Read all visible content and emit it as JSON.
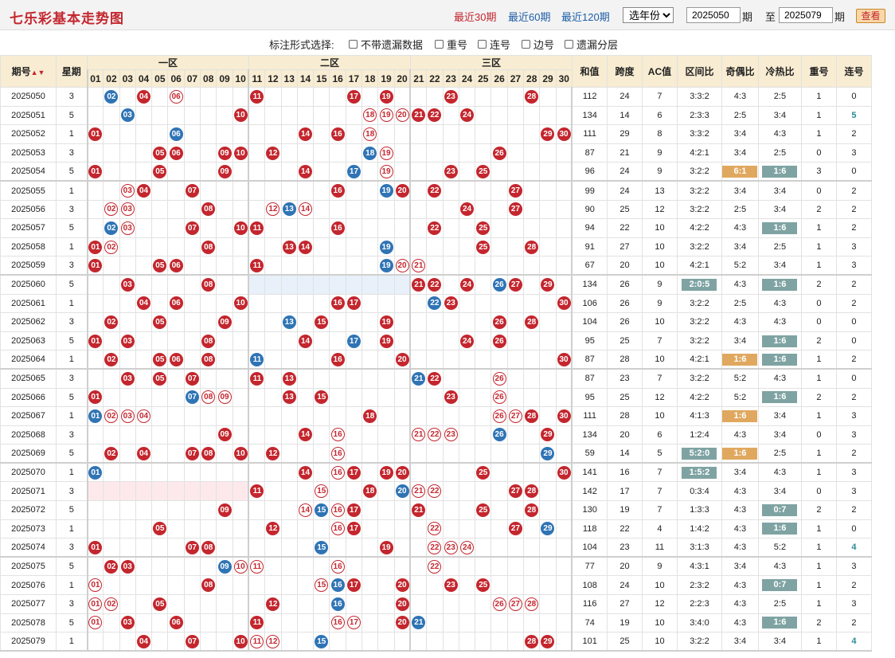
{
  "header": {
    "title": "七乐彩基本走势图",
    "periods": [
      "最近30期",
      "最近60期",
      "最近120期"
    ],
    "year_select": "选年份",
    "from": "2025050",
    "to": "2025079",
    "label_qi": "期",
    "label_zhi": "至",
    "query": "查看"
  },
  "options": {
    "label": "标注形式选择:",
    "items": [
      "不带遗漏数据",
      "重号",
      "连号",
      "边号",
      "遗漏分层"
    ]
  },
  "columns": {
    "issue": "期号",
    "week": "星期",
    "zones": [
      "一区",
      "二区",
      "三区"
    ],
    "sum": "和值",
    "span": "跨度",
    "ac": "AC值",
    "zone_ratio": "区间比",
    "odd_even": "奇偶比",
    "hot_cold": "冷热比",
    "repeat": "重号",
    "consec": "连号"
  },
  "numbers": [
    "01",
    "02",
    "03",
    "04",
    "05",
    "06",
    "07",
    "08",
    "09",
    "10",
    "11",
    "12",
    "13",
    "14",
    "15",
    "16",
    "17",
    "18",
    "19",
    "20",
    "21",
    "22",
    "23",
    "24",
    "25",
    "26",
    "27",
    "28",
    "29",
    "30"
  ],
  "colors": {
    "red": "#c4262e",
    "blue": "#2f74b5",
    "tag_gray": "#7fa3a3",
    "tag_orange": "#e0a85f",
    "header_bg": "#f8ecd2"
  },
  "rows": [
    {
      "i": "2025050",
      "w": "3",
      "r": [
        4,
        11,
        17,
        19,
        23,
        28
      ],
      "o": [
        6
      ],
      "bl": [
        2
      ],
      "s": "112",
      "sp": "24",
      "ac": "7",
      "zr": "3:3:2",
      "oe": "4:3",
      "hc": "2:5",
      "rp": "1",
      "cn": "0"
    },
    {
      "i": "2025051",
      "w": "5",
      "r": [
        10,
        21,
        22,
        24
      ],
      "o": [
        18,
        19,
        20
      ],
      "bl": [
        3
      ],
      "s": "134",
      "sp": "14",
      "ac": "6",
      "zr": "2:3:3",
      "oe": "2:5",
      "hc": "3:4",
      "rp": "1",
      "cn": "5",
      "cnh": true
    },
    {
      "i": "2025052",
      "w": "1",
      "r": [
        1,
        14,
        16,
        29,
        30
      ],
      "o": [
        18
      ],
      "bl": [
        6
      ],
      "s": "111",
      "sp": "29",
      "ac": "8",
      "zr": "3:3:2",
      "oe": "3:4",
      "hc": "4:3",
      "rp": "1",
      "cn": "2"
    },
    {
      "i": "2025053",
      "w": "3",
      "r": [
        5,
        6,
        9,
        10,
        12,
        26
      ],
      "o": [
        19
      ],
      "bl": [
        18
      ],
      "s": "87",
      "sp": "21",
      "ac": "9",
      "zr": "4:2:1",
      "oe": "3:4",
      "hc": "2:5",
      "rp": "0",
      "cn": "3"
    },
    {
      "i": "2025054",
      "w": "5",
      "r": [
        1,
        5,
        9,
        14,
        23,
        25
      ],
      "o": [
        19
      ],
      "bl": [
        17
      ],
      "s": "96",
      "sp": "24",
      "ac": "9",
      "zr": "3:2:2",
      "oe": "6:1",
      "oet": "or",
      "hc": "1:6",
      "hct": "gr",
      "rp": "3",
      "cn": "0"
    },
    {
      "i": "2025055",
      "w": "1",
      "r": [
        4,
        7,
        16,
        20,
        22,
        27
      ],
      "o": [
        3
      ],
      "bl": [
        19
      ],
      "s": "99",
      "sp": "24",
      "ac": "13",
      "zr": "3:2:2",
      "oe": "3:4",
      "hc": "3:4",
      "rp": "0",
      "cn": "2"
    },
    {
      "i": "2025056",
      "w": "3",
      "r": [
        8,
        24,
        27
      ],
      "o": [
        2,
        3,
        12,
        14
      ],
      "bl": [
        13
      ],
      "s": "90",
      "sp": "25",
      "ac": "12",
      "zr": "3:2:2",
      "oe": "2:5",
      "hc": "3:4",
      "rp": "2",
      "cn": "2"
    },
    {
      "i": "2025057",
      "w": "5",
      "r": [
        7,
        10,
        11,
        16,
        22,
        25
      ],
      "o": [
        3
      ],
      "bl": [
        2
      ],
      "s": "94",
      "sp": "22",
      "ac": "10",
      "zr": "4:2:2",
      "oe": "4:3",
      "hc": "1:6",
      "hct": "gr",
      "rp": "1",
      "cn": "2"
    },
    {
      "i": "2025058",
      "w": "1",
      "r": [
        1,
        8,
        13,
        14,
        25,
        28
      ],
      "o": [
        2
      ],
      "bl": [
        19
      ],
      "s": "91",
      "sp": "27",
      "ac": "10",
      "zr": "3:2:2",
      "oe": "3:4",
      "hc": "2:5",
      "rp": "1",
      "cn": "3"
    },
    {
      "i": "2025059",
      "w": "3",
      "r": [
        1,
        5,
        6,
        11
      ],
      "o": [
        20,
        21
      ],
      "bl": [
        19
      ],
      "s": "67",
      "sp": "20",
      "ac": "10",
      "zr": "4:2:1",
      "oe": "5:2",
      "hc": "3:4",
      "rp": "1",
      "cn": "3"
    },
    {
      "i": "2025060",
      "w": "5",
      "r": [
        3,
        8,
        21,
        22,
        24,
        27,
        29
      ],
      "o": [],
      "bl": [
        26
      ],
      "s": "134",
      "sp": "26",
      "ac": "9",
      "zr": "2:0:5",
      "zrt": "gr",
      "oe": "4:3",
      "hc": "1:6",
      "hct": "gr",
      "rp": "2",
      "cn": "2",
      "sh": "z2"
    },
    {
      "i": "2025061",
      "w": "1",
      "r": [
        4,
        6,
        10,
        16,
        17,
        23,
        30
      ],
      "o": [],
      "bl": [
        22
      ],
      "s": "106",
      "sp": "26",
      "ac": "9",
      "zr": "3:2:2",
      "oe": "2:5",
      "hc": "4:3",
      "rp": "0",
      "cn": "2"
    },
    {
      "i": "2025062",
      "w": "3",
      "r": [
        2,
        5,
        9,
        15,
        19,
        26,
        28
      ],
      "o": [],
      "bl": [
        13
      ],
      "s": "104",
      "sp": "26",
      "ac": "10",
      "zr": "3:2:2",
      "oe": "4:3",
      "hc": "4:3",
      "rp": "0",
      "cn": "0"
    },
    {
      "i": "2025063",
      "w": "5",
      "r": [
        1,
        3,
        8,
        14,
        19,
        24,
        26
      ],
      "o": [],
      "bl": [
        17
      ],
      "s": "95",
      "sp": "25",
      "ac": "7",
      "zr": "3:2:2",
      "oe": "3:4",
      "hc": "1:6",
      "hct": "gr",
      "rp": "2",
      "cn": "0"
    },
    {
      "i": "2025064",
      "w": "1",
      "r": [
        2,
        5,
        6,
        8,
        16,
        20,
        30
      ],
      "o": [],
      "bl": [
        11
      ],
      "s": "87",
      "sp": "28",
      "ac": "10",
      "zr": "4:2:1",
      "oe": "1:6",
      "oet": "or",
      "hc": "1:6",
      "hct": "gr",
      "rp": "1",
      "cn": "2"
    },
    {
      "i": "2025065",
      "w": "3",
      "r": [
        3,
        5,
        7,
        11,
        13,
        22
      ],
      "o": [
        26
      ],
      "bl": [
        21
      ],
      "s": "87",
      "sp": "23",
      "ac": "7",
      "zr": "3:2:2",
      "oe": "5:2",
      "hc": "4:3",
      "rp": "1",
      "cn": "0"
    },
    {
      "i": "2025066",
      "w": "5",
      "r": [
        1,
        13,
        15,
        23
      ],
      "o": [
        8,
        9,
        26
      ],
      "bl": [
        7
      ],
      "s": "95",
      "sp": "25",
      "ac": "12",
      "zr": "4:2:2",
      "oe": "5:2",
      "hc": "1:6",
      "hct": "gr",
      "rp": "2",
      "cn": "2"
    },
    {
      "i": "2025067",
      "w": "1",
      "r": [
        18,
        28,
        30
      ],
      "o": [
        2,
        3,
        4,
        26,
        27
      ],
      "bl": [
        1
      ],
      "s": "111",
      "sp": "28",
      "ac": "10",
      "zr": "4:1:3",
      "oe": "1:6",
      "oet": "or",
      "hc": "3:4",
      "rp": "1",
      "cn": "3"
    },
    {
      "i": "2025068",
      "w": "3",
      "r": [
        9,
        14,
        29
      ],
      "o": [
        16,
        21,
        22,
        23
      ],
      "bl": [
        26
      ],
      "s": "134",
      "sp": "20",
      "ac": "6",
      "zr": "1:2:4",
      "oe": "4:3",
      "hc": "3:4",
      "rp": "0",
      "cn": "3"
    },
    {
      "i": "2025069",
      "w": "5",
      "r": [
        2,
        4,
        7,
        8,
        10,
        12
      ],
      "o": [
        16
      ],
      "bl": [
        29
      ],
      "s": "59",
      "sp": "14",
      "ac": "5",
      "zr": "5:2:0",
      "zrt": "gr",
      "oe": "1:6",
      "oet": "or",
      "hc": "2:5",
      "rp": "1",
      "cn": "2"
    },
    {
      "i": "2025070",
      "w": "1",
      "r": [
        14,
        17,
        19,
        20,
        25,
        30
      ],
      "o": [
        16
      ],
      "bl": [
        1
      ],
      "s": "141",
      "sp": "16",
      "ac": "7",
      "zr": "1:5:2",
      "zrt": "gr",
      "oe": "3:4",
      "hc": "4:3",
      "rp": "1",
      "cn": "3"
    },
    {
      "i": "2025071",
      "w": "3",
      "r": [
        11,
        18,
        27,
        28
      ],
      "o": [
        15,
        21,
        22
      ],
      "bl": [
        20
      ],
      "s": "142",
      "sp": "17",
      "ac": "7",
      "zr": "0:3:4",
      "oe": "4:3",
      "hc": "3:4",
      "rp": "0",
      "cn": "3",
      "sh": "z1"
    },
    {
      "i": "2025072",
      "w": "5",
      "r": [
        9,
        17,
        21,
        25,
        28
      ],
      "o": [
        14,
        16
      ],
      "bl": [
        15
      ],
      "s": "130",
      "sp": "19",
      "ac": "7",
      "zr": "1:3:3",
      "oe": "4:3",
      "hc": "0:7",
      "hct": "gr",
      "rp": "2",
      "cn": "2"
    },
    {
      "i": "2025073",
      "w": "1",
      "r": [
        5,
        12,
        17,
        27
      ],
      "o": [
        16,
        22
      ],
      "bl": [
        29
      ],
      "s": "118",
      "sp": "22",
      "ac": "4",
      "zr": "1:4:2",
      "oe": "4:3",
      "hc": "1:6",
      "hct": "gr",
      "rp": "1",
      "cn": "0"
    },
    {
      "i": "2025074",
      "w": "3",
      "r": [
        1,
        7,
        8,
        19
      ],
      "o": [
        22,
        23,
        24
      ],
      "bl": [
        15
      ],
      "s": "104",
      "sp": "23",
      "ac": "11",
      "zr": "3:1:3",
      "oe": "4:3",
      "hc": "5:2",
      "rp": "1",
      "cn": "4",
      "cnh": true
    },
    {
      "i": "2025075",
      "w": "5",
      "r": [
        2,
        3
      ],
      "o": [
        10,
        11,
        16,
        22
      ],
      "bl": [
        9
      ],
      "s": "77",
      "sp": "20",
      "ac": "9",
      "zr": "4:3:1",
      "oe": "3:4",
      "hc": "4:3",
      "rp": "1",
      "cn": "3"
    },
    {
      "i": "2025076",
      "w": "1",
      "r": [
        8,
        17,
        20,
        23,
        25
      ],
      "o": [
        1,
        15
      ],
      "bl": [
        16
      ],
      "s": "108",
      "sp": "24",
      "ac": "10",
      "zr": "2:3:2",
      "oe": "4:3",
      "hc": "0:7",
      "hct": "gr",
      "rp": "1",
      "cn": "2"
    },
    {
      "i": "2025077",
      "w": "3",
      "r": [
        5,
        12,
        20
      ],
      "o": [
        1,
        2,
        26,
        27,
        28
      ],
      "bl": [
        16
      ],
      "s": "116",
      "sp": "27",
      "ac": "12",
      "zr": "2:2:3",
      "oe": "4:3",
      "hc": "2:5",
      "rp": "1",
      "cn": "3"
    },
    {
      "i": "2025078",
      "w": "5",
      "r": [
        3,
        6,
        11,
        20
      ],
      "o": [
        1,
        16,
        17
      ],
      "bl": [
        21
      ],
      "s": "74",
      "sp": "19",
      "ac": "10",
      "zr": "3:4:0",
      "oe": "4:3",
      "hc": "1:6",
      "hct": "gr",
      "rp": "2",
      "cn": "2"
    },
    {
      "i": "2025079",
      "w": "1",
      "r": [
        4,
        7,
        10,
        28,
        29
      ],
      "o": [
        11,
        12
      ],
      "bl": [
        15
      ],
      "s": "101",
      "sp": "25",
      "ac": "10",
      "zr": "3:2:2",
      "oe": "3:4",
      "hc": "3:4",
      "rp": "1",
      "cn": "4",
      "cnh": true
    }
  ]
}
